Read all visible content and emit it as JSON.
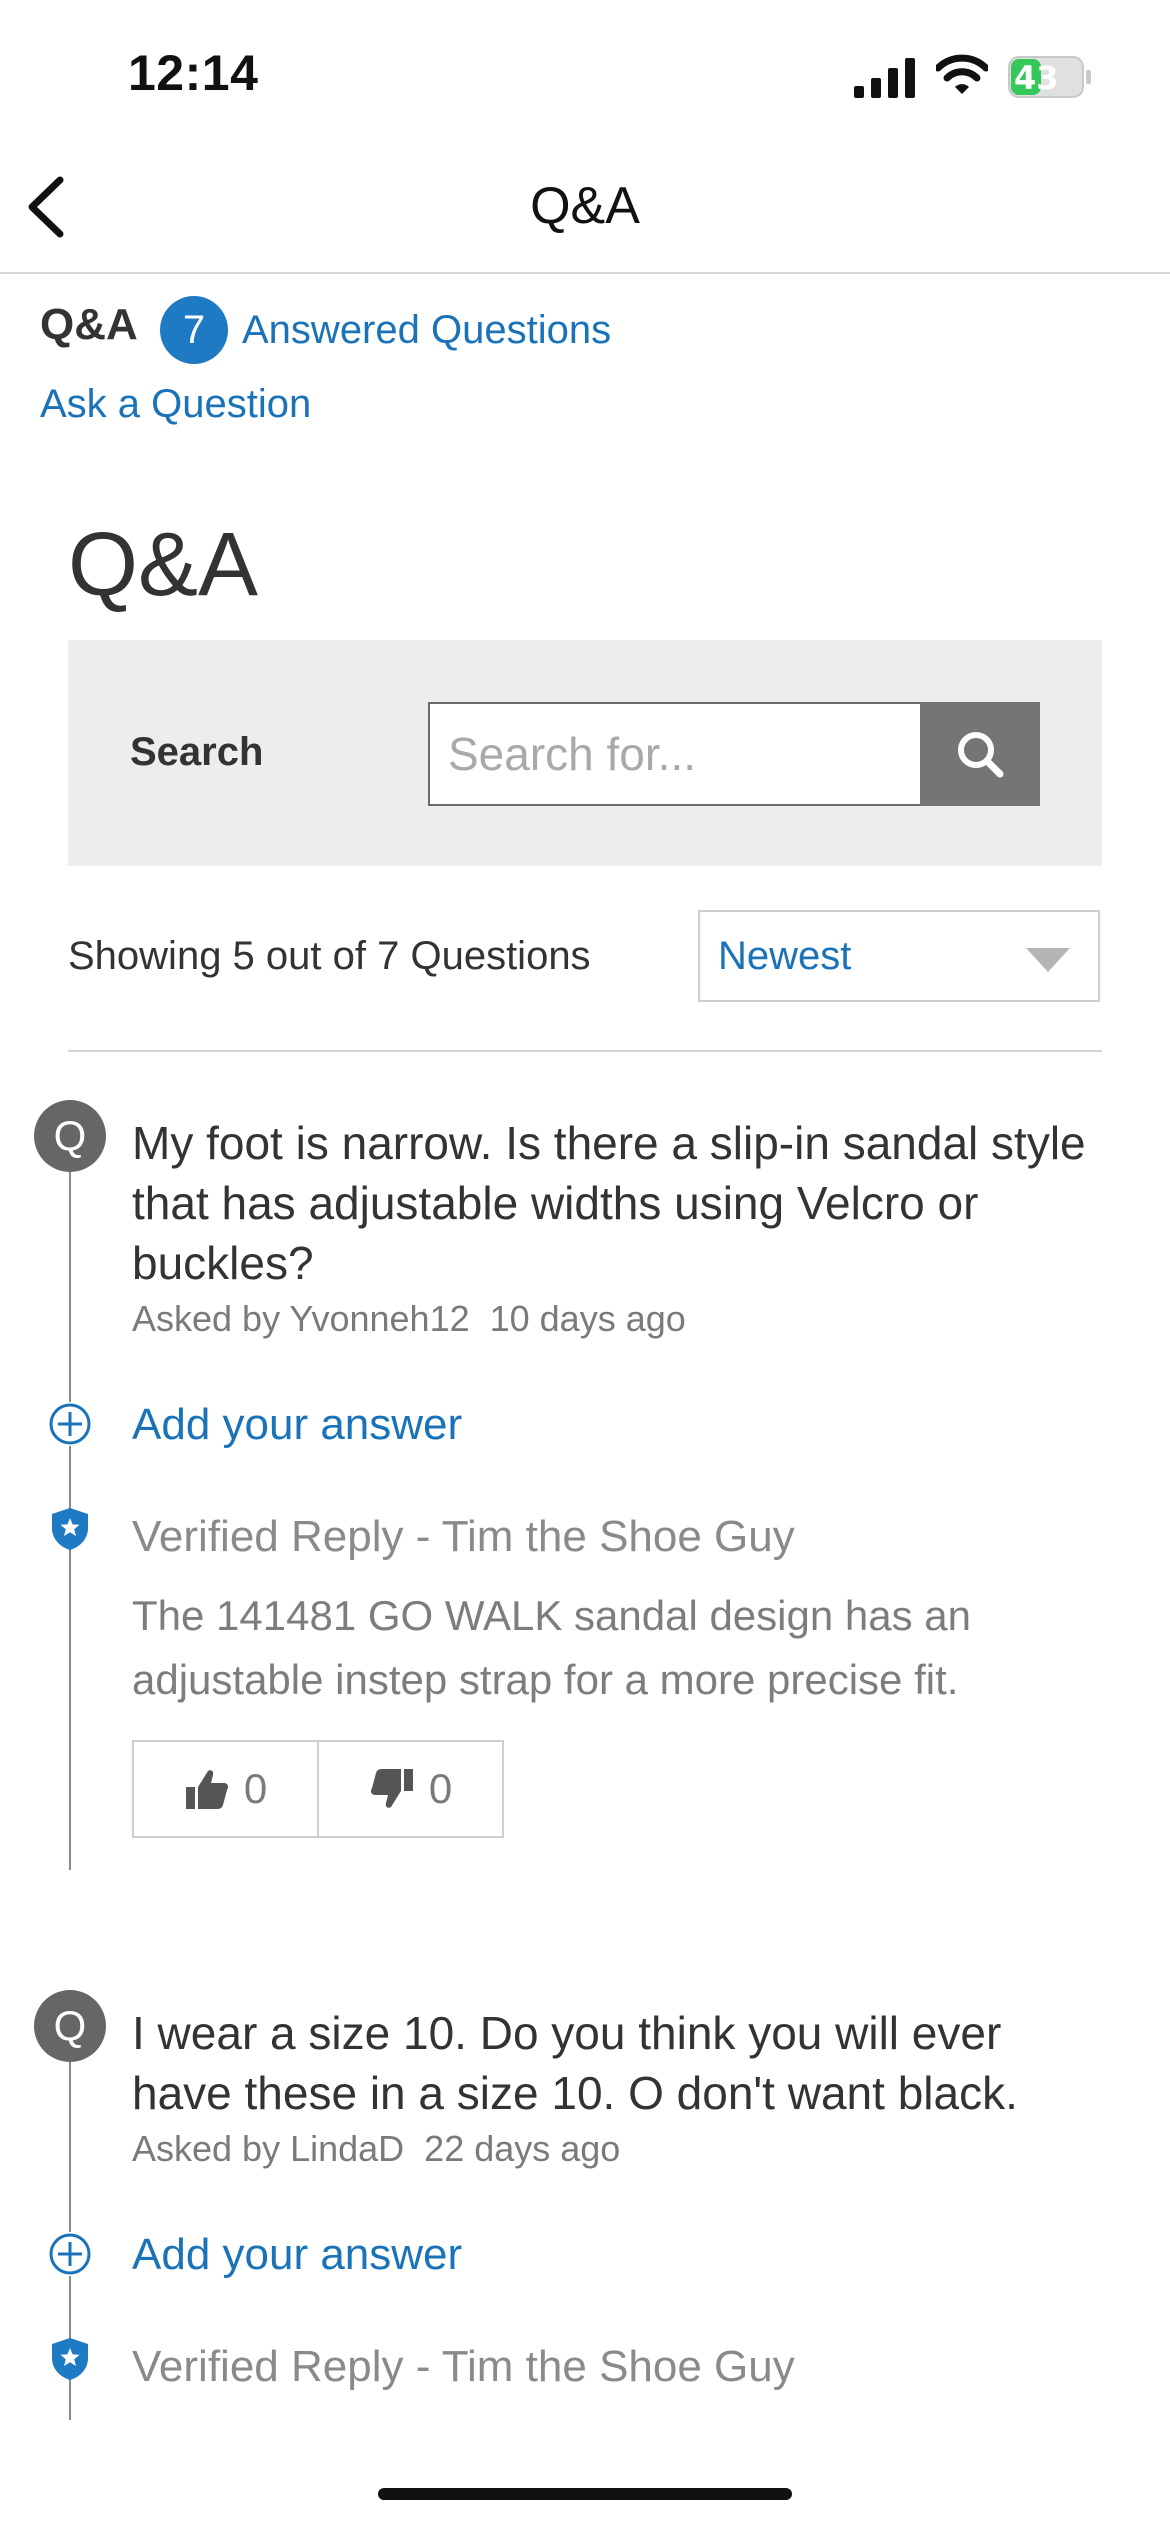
{
  "status_bar": {
    "time": "12:14",
    "battery_level": "43"
  },
  "nav": {
    "title": "Q&A",
    "back_icon": "chevron-left-icon"
  },
  "summary": {
    "title": "Q&A",
    "count": "7",
    "answered_link": "Answered Questions",
    "ask_link": "Ask a Question"
  },
  "section_title": "Q&A",
  "search": {
    "label": "Search",
    "placeholder": "Search for...",
    "icon": "search-icon"
  },
  "results": {
    "showing": "Showing 5 out of 7 Questions",
    "sort_value": "Newest"
  },
  "questions": [
    {
      "badge": "Q",
      "text": "My foot is narrow. Is there a slip-in sandal style that has adjustable widths using Velcro or buckles?",
      "asked_by": "Asked by Yvonneh12",
      "age": "10 days ago",
      "add_answer": "Add your answer",
      "reply": {
        "header": "Verified Reply - Tim the Shoe Guy",
        "body": "The 141481 GO WALK sandal design has an adjustable instep strap for a more precise fit.",
        "upvotes": "0",
        "downvotes": "0"
      }
    },
    {
      "badge": "Q",
      "text": "I wear a size 10. Do you think you will ever have these in a size 10. O don't want black.",
      "asked_by": "Asked by LindaD",
      "age": "22 days ago",
      "add_answer": "Add your answer",
      "reply": {
        "header": "Verified Reply - Tim the Shoe Guy"
      }
    }
  ],
  "colors": {
    "link": "#1a73b8",
    "badge": "#1f7ac4",
    "search_button": "#757575",
    "battery": "#34c759"
  }
}
